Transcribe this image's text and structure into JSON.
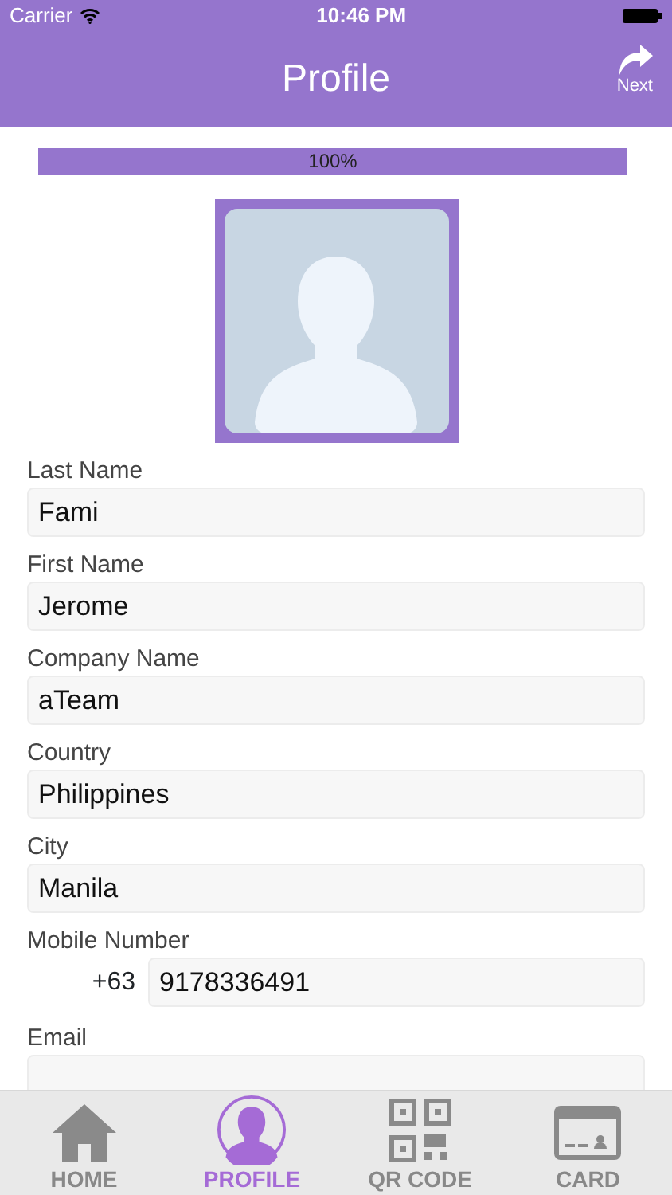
{
  "status_bar": {
    "carrier": "Carrier",
    "time": "10:46 PM"
  },
  "nav_bar": {
    "title": "Profile",
    "next_label": "Next"
  },
  "progress": {
    "level": 1,
    "reading": "100%"
  },
  "fields": [
    {
      "kind": "text",
      "label": "Last Name",
      "value": "Fami"
    },
    {
      "kind": "text",
      "label": "First Name",
      "value": "Jerome"
    },
    {
      "kind": "text",
      "label": "Company Name",
      "value": "aTeam"
    },
    {
      "kind": "text",
      "label": "Country",
      "value": "Philippines"
    },
    {
      "kind": "text",
      "label": "City",
      "value": "Manila"
    },
    {
      "kind": "phone",
      "label": "Mobile Number",
      "prefix": "+63",
      "value": "9178336491"
    },
    {
      "kind": "text",
      "label": "Email"
    }
  ],
  "tabs": [
    {
      "kind": "home",
      "label": "HOME",
      "selected": false
    },
    {
      "kind": "profile",
      "label": "PROFILE",
      "selected": true
    },
    {
      "kind": "qr",
      "label": "QR CODE",
      "selected": false
    },
    {
      "kind": "card",
      "label": "CARD",
      "selected": false
    }
  ]
}
